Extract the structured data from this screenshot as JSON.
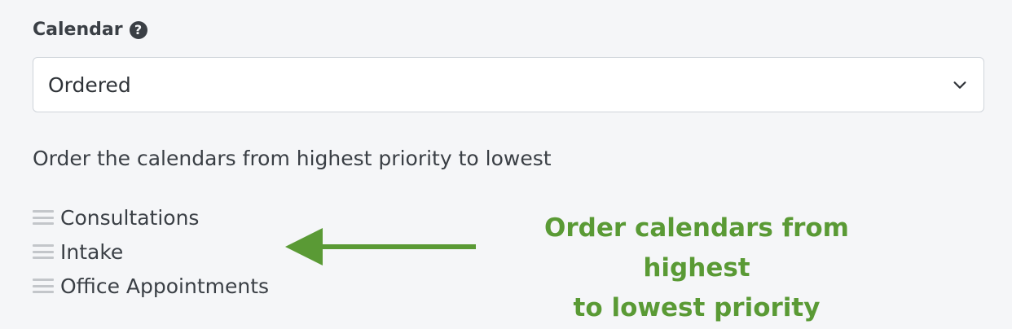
{
  "field": {
    "label": "Calendar",
    "help_icon": "question-circle-icon",
    "help_glyph": "?"
  },
  "select": {
    "value": "Ordered"
  },
  "instructions": "Order the calendars from highest priority to lowest",
  "calendars": [
    {
      "label": "Consultations"
    },
    {
      "label": "Intake"
    },
    {
      "label": "Office Appointments"
    }
  ],
  "annotation": {
    "line1": "Order calendars from highest",
    "line2": "to lowest priority",
    "color": "#5a9a35"
  },
  "colors": {
    "background": "#f5f6f8",
    "text": "#3a3f45",
    "border": "#cfd4da",
    "handle": "#c3c6ca"
  }
}
